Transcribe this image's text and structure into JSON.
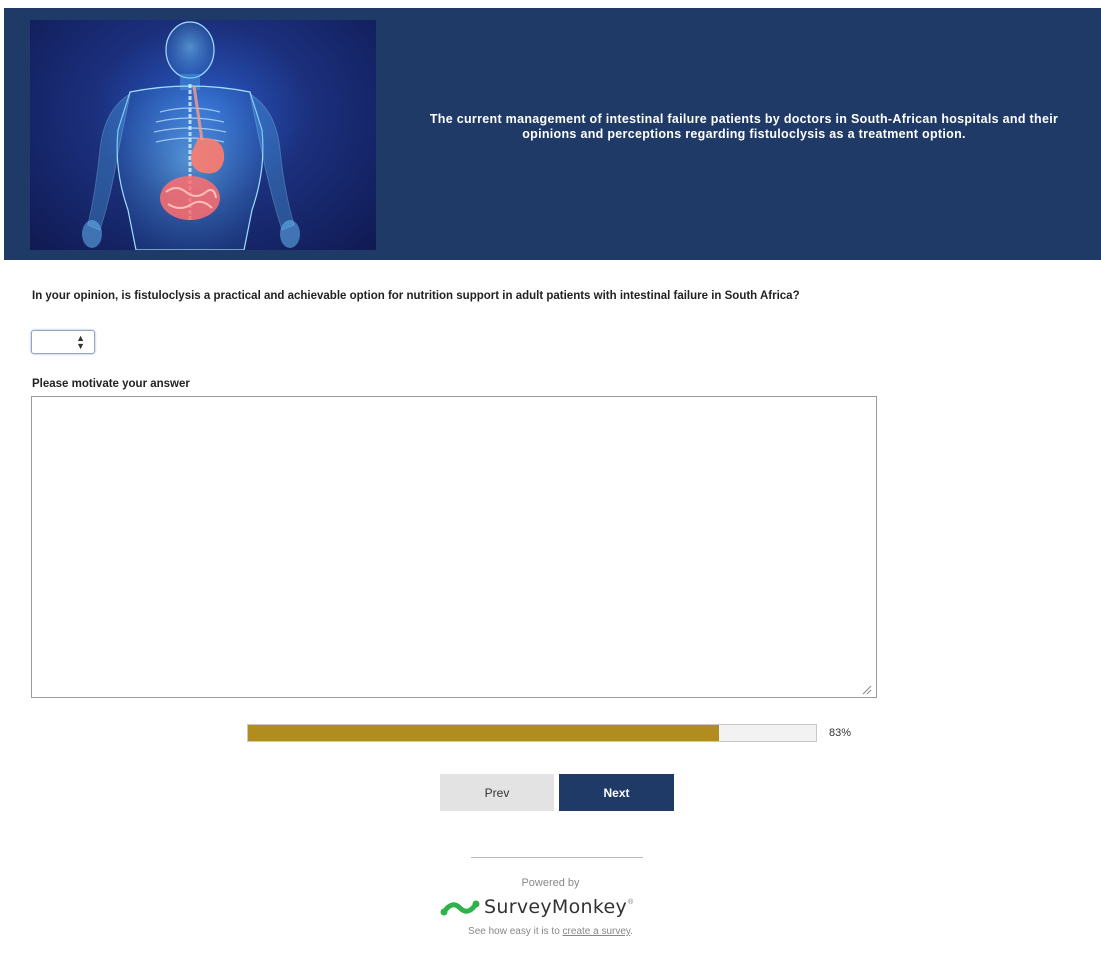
{
  "header": {
    "title": "The current management of intestinal failure patients by doctors in South-African hospitals and their opinions and perceptions regarding fistuloclysis as a treatment option.",
    "image_icon": "human-anatomy-digestive-system-illustration"
  },
  "question": {
    "text": "In your opinion, is fistuloclysis a practical and achievable option for nutrition support in adult patients with intestinal failure in South Africa?",
    "select_value": "",
    "select_icon": "updown-chevron-icon"
  },
  "motivate": {
    "label": "Please motivate your answer",
    "value": ""
  },
  "progress": {
    "percent": 83,
    "label": "83%"
  },
  "nav": {
    "prev_label": "Prev",
    "next_label": "Next"
  },
  "footer": {
    "powered_by": "Powered by",
    "brand": "SurveyMonkey",
    "tm": "®",
    "line_prefix": "See how easy it is to ",
    "link_text": "create a survey",
    "line_suffix": "."
  },
  "colors": {
    "header_bg": "#1f3a66",
    "progress_fill": "#b08d1e",
    "next_button": "#1f3a66",
    "prev_button": "#e3e3e3",
    "brand_green": "#2fb24c"
  }
}
